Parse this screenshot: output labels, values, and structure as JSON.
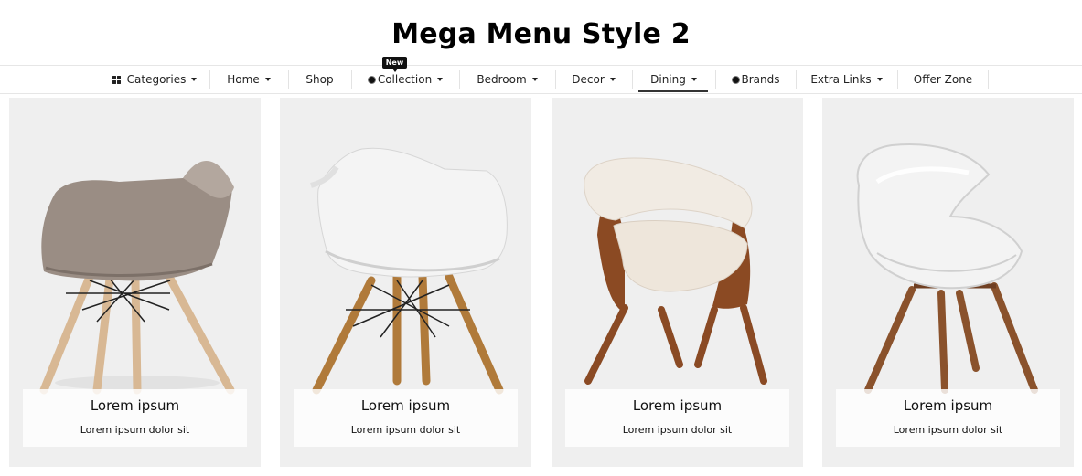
{
  "page": {
    "title": "Mega Menu Style 2"
  },
  "nav": {
    "items": [
      {
        "label": "Categories",
        "icon": "grid-icon",
        "dropdown": true
      },
      {
        "label": "Home",
        "dropdown": true
      },
      {
        "label": "Shop",
        "dropdown": false
      },
      {
        "label": "Collection",
        "icon": "dot-icon",
        "dropdown": true,
        "badge": "New"
      },
      {
        "label": "Bedroom",
        "dropdown": true
      },
      {
        "label": "Decor",
        "dropdown": true
      },
      {
        "label": "Dining",
        "dropdown": true,
        "active": true
      },
      {
        "label": "Brands",
        "icon": "dot-icon",
        "dropdown": false
      },
      {
        "label": "Extra Links",
        "dropdown": true
      },
      {
        "label": "Offer Zone",
        "dropdown": false
      }
    ]
  },
  "cards": [
    {
      "title": "Lorem ipsum",
      "subtitle": "Lorem ipsum dolor sit",
      "image": "taupe-shell-chair-image"
    },
    {
      "title": "Lorem ipsum",
      "subtitle": "Lorem ipsum dolor sit",
      "image": "white-shell-chair-image"
    },
    {
      "title": "Lorem ipsum",
      "subtitle": "Lorem ipsum dolor sit",
      "image": "cream-wooden-chair-image"
    },
    {
      "title": "Lorem ipsum",
      "subtitle": "Lorem ipsum dolor sit",
      "image": "white-lounge-chair-image"
    }
  ],
  "colors": {
    "card_bg": "#efefef",
    "text": "#111111",
    "badge_bg": "#111111",
    "divider": "#e3e3e3"
  }
}
